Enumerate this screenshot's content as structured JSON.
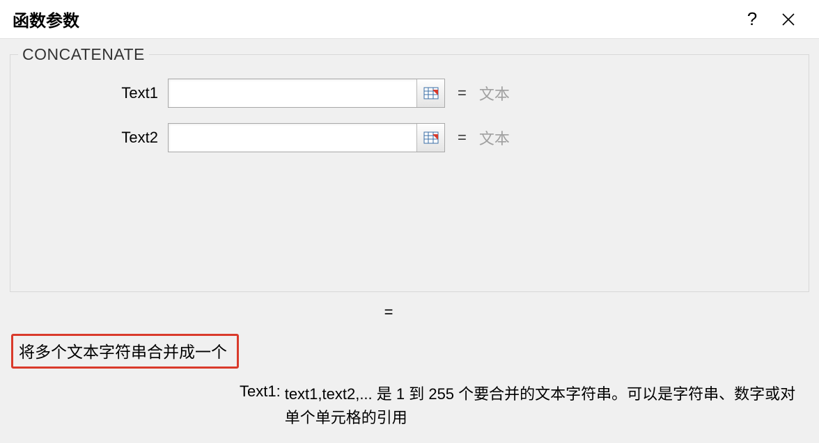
{
  "title": "函数参数",
  "function_name": "CONCATENATE",
  "params": {
    "text1": {
      "label": "Text1",
      "value": "",
      "hint": "文本"
    },
    "text2": {
      "label": "Text2",
      "value": "",
      "hint": "文本"
    }
  },
  "equals_sign": "=",
  "result_prefix": "=",
  "description": "将多个文本字符串合并成一个",
  "detail": {
    "label": "Text1:",
    "text": "text1,text2,... 是 1 到 255 个要合并的文本字符串。可以是字符串、数字或对单个单元格的引用"
  }
}
